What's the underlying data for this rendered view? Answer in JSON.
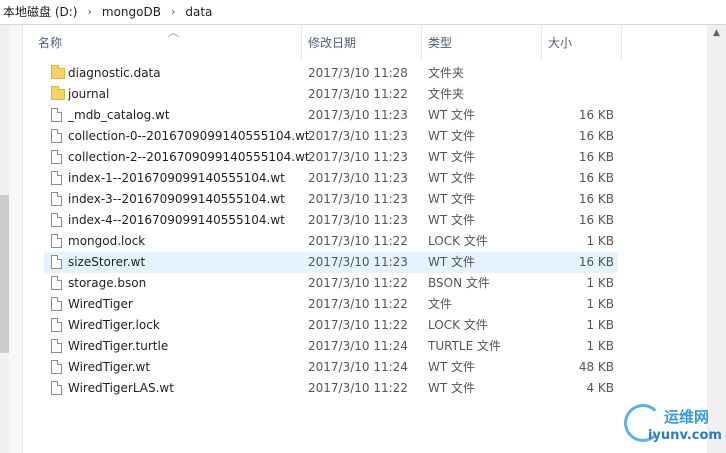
{
  "breadcrumb": [
    "本地磁盘 (D:)",
    "mongoDB",
    "data"
  ],
  "columns": {
    "name": "名称",
    "date": "修改日期",
    "type": "类型",
    "size": "大小"
  },
  "files": [
    {
      "name": "diagnostic.data",
      "date": "2017/3/10 11:28",
      "type": "文件夹",
      "size": "",
      "kind": "folder"
    },
    {
      "name": "journal",
      "date": "2017/3/10 11:22",
      "type": "文件夹",
      "size": "",
      "kind": "folder"
    },
    {
      "name": "_mdb_catalog.wt",
      "date": "2017/3/10 11:23",
      "type": "WT 文件",
      "size": "16 KB",
      "kind": "file"
    },
    {
      "name": "collection-0--2016709099140555104.wt",
      "date": "2017/3/10 11:23",
      "type": "WT 文件",
      "size": "16 KB",
      "kind": "file"
    },
    {
      "name": "collection-2--2016709099140555104.wt",
      "date": "2017/3/10 11:23",
      "type": "WT 文件",
      "size": "16 KB",
      "kind": "file"
    },
    {
      "name": "index-1--2016709099140555104.wt",
      "date": "2017/3/10 11:23",
      "type": "WT 文件",
      "size": "16 KB",
      "kind": "file"
    },
    {
      "name": "index-3--2016709099140555104.wt",
      "date": "2017/3/10 11:23",
      "type": "WT 文件",
      "size": "16 KB",
      "kind": "file"
    },
    {
      "name": "index-4--2016709099140555104.wt",
      "date": "2017/3/10 11:23",
      "type": "WT 文件",
      "size": "16 KB",
      "kind": "file"
    },
    {
      "name": "mongod.lock",
      "date": "2017/3/10 11:22",
      "type": "LOCK 文件",
      "size": "1 KB",
      "kind": "file"
    },
    {
      "name": "sizeStorer.wt",
      "date": "2017/3/10 11:23",
      "type": "WT 文件",
      "size": "16 KB",
      "kind": "file",
      "selected": true
    },
    {
      "name": "storage.bson",
      "date": "2017/3/10 11:22",
      "type": "BSON 文件",
      "size": "1 KB",
      "kind": "file"
    },
    {
      "name": "WiredTiger",
      "date": "2017/3/10 11:22",
      "type": "文件",
      "size": "1 KB",
      "kind": "file"
    },
    {
      "name": "WiredTiger.lock",
      "date": "2017/3/10 11:22",
      "type": "LOCK 文件",
      "size": "1 KB",
      "kind": "file"
    },
    {
      "name": "WiredTiger.turtle",
      "date": "2017/3/10 11:24",
      "type": "TURTLE 文件",
      "size": "1 KB",
      "kind": "file"
    },
    {
      "name": "WiredTiger.wt",
      "date": "2017/3/10 11:24",
      "type": "WT 文件",
      "size": "48 KB",
      "kind": "file"
    },
    {
      "name": "WiredTigerLAS.wt",
      "date": "2017/3/10 11:22",
      "type": "WT 文件",
      "size": "4 KB",
      "kind": "file"
    }
  ],
  "watermark": {
    "line1": "运维网",
    "line2": "iyunv.com"
  }
}
